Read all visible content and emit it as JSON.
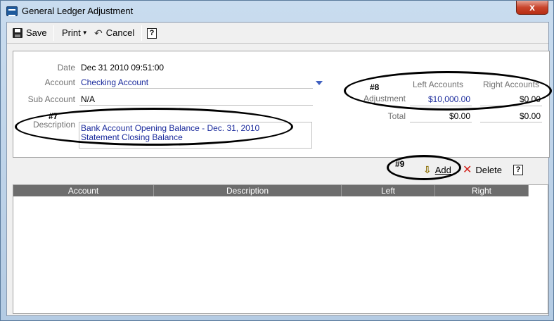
{
  "window": {
    "title": "General Ledger Adjustment",
    "close_label": "x"
  },
  "toolbar": {
    "save_label": "Save",
    "print_label": "Print",
    "cancel_label": "Cancel",
    "help_label": "?"
  },
  "form": {
    "date_label": "Date",
    "date_value": "Dec 31 2010 09:51:00",
    "account_label": "Account",
    "account_value": "Checking Account",
    "sub_account_label": "Sub Account",
    "sub_account_value": "N/A",
    "description_label": "Description",
    "description_value": "Bank Account Opening Balance - Dec. 31, 2010\nStatement Closing Balance"
  },
  "totals": {
    "left_header": "Left Accounts",
    "right_header": "Right Accounts",
    "adjustment_label": "Adjustment",
    "adjustment_left": "$10,000.00",
    "adjustment_right": "$0.00",
    "total_label": "Total",
    "total_left": "$0.00",
    "total_right": "$0.00"
  },
  "annotations": {
    "a7": "#7",
    "a8": "#8",
    "a9": "#9"
  },
  "actions": {
    "add_label": "Add",
    "delete_label": "Delete",
    "help_label": "?"
  },
  "grid": {
    "columns": [
      "Account",
      "Description",
      "Left",
      "Right"
    ]
  },
  "colors": {
    "value_blue": "#1a2a9c",
    "header_gray": "#6d6d6d"
  }
}
